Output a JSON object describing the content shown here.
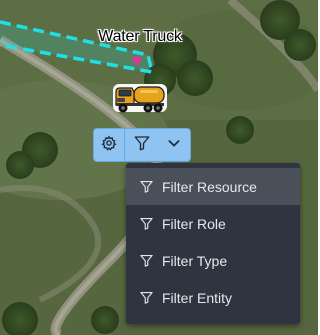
{
  "map": {
    "vehicle_label": "Water Truck"
  },
  "toolbar": {
    "settings_icon": "gear-icon",
    "filter_icon": "filter-icon",
    "dropdown_icon": "chevron-down-icon"
  },
  "filter_menu": {
    "items": [
      {
        "label": "Filter Resource",
        "icon": "filter-icon",
        "active": true
      },
      {
        "label": "Filter Role",
        "icon": "filter-icon",
        "active": false
      },
      {
        "label": "Filter Type",
        "icon": "filter-icon",
        "active": false
      },
      {
        "label": "Filter Entity",
        "icon": "filter-icon",
        "active": false
      }
    ]
  },
  "colors": {
    "geofence": "#1fe0e6",
    "marker": "#e0359a",
    "toolbar_bg": "#8fc4f2",
    "menu_bg": "#2f3540",
    "menu_active_bg": "#4a505a"
  }
}
